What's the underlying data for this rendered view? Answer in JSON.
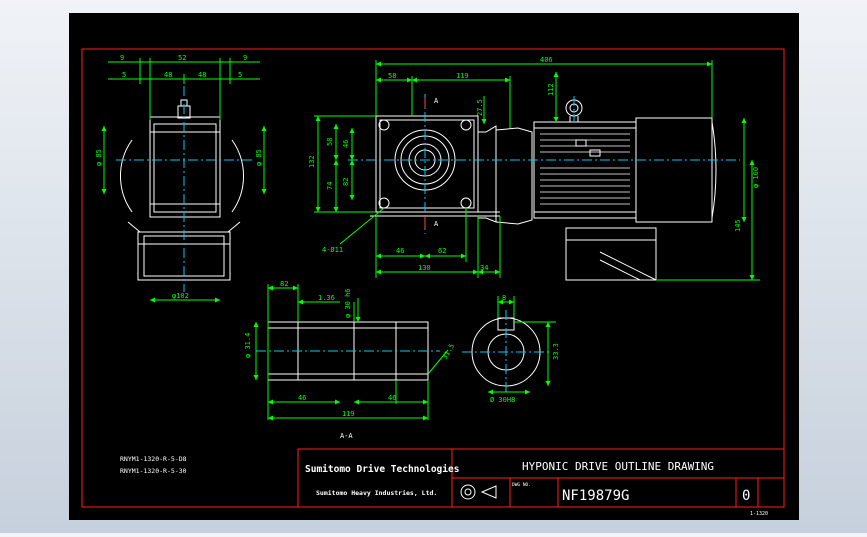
{
  "colors": {
    "background": "#000000",
    "frame": "#ff2020",
    "object": "#ffffff",
    "dimension": "#00ff00",
    "center": "#00c8ff",
    "section": "#ff4040",
    "text": "#ffffff",
    "canvas_bg": "#e6ebf1"
  },
  "title_block": {
    "company": "Sumitomo Drive Technologies",
    "parent": "Sumitomo Heavy Industries, Ltd.",
    "title": "HYPONIC DRIVE OUTLINE DRAWING",
    "dwg_label": "DWG NO.",
    "drawing_number": "NF19879G",
    "revision": "0",
    "sheet_tag": "1-1320"
  },
  "model_notes": [
    "RNYM1-1320-R-5-D8",
    "RNYM1-1320-R-5-30"
  ],
  "section_labels": {
    "view": "A-A",
    "arrow_top": "A",
    "arrow_bottom": "A"
  },
  "dimensions": {
    "left_view": {
      "top_9a": "9",
      "top_52": "52",
      "top_9b": "9",
      "row2_5": "5",
      "row2_48a": "48",
      "row2_48b": "48",
      "row2_5b": "5",
      "left_dia": "φ 85",
      "right_dia": "φ 85",
      "bottom_dia": "φ102"
    },
    "front_view": {
      "overall": "406",
      "w58": "58",
      "w119": "119",
      "h112": "112",
      "h27_5": "27.5",
      "h58": "58",
      "h46": "46",
      "h132": "132",
      "h74": "74",
      "h82": "82",
      "holes": "4-Ø11",
      "b46": "46",
      "b62": "62",
      "b130": "130",
      "b34": "34",
      "motor_dia": "φ 160",
      "h145": "145"
    },
    "shaft_view": {
      "d1_36": "1.36",
      "d30": "φ 30 h6",
      "d82": "82",
      "dia31_4": "φ 31.4",
      "d31_5": "31.5",
      "b46a": "46",
      "b46b": "46",
      "overall": "119"
    },
    "bore_view": {
      "key8": "8",
      "d33_3": "33.3",
      "bore": "Ø 30H8"
    }
  }
}
